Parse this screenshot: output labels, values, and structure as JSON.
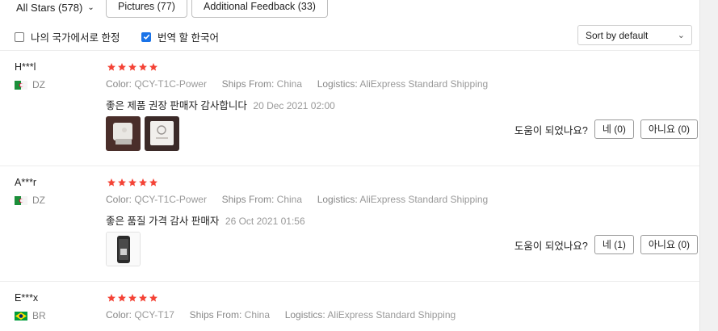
{
  "filters": {
    "all_stars": "All Stars (578)",
    "pictures": "Pictures (77)",
    "additional_feedback": "Additional Feedback (33)"
  },
  "checkboxes": {
    "local_country": {
      "label": "나의 국가에서로 한정",
      "checked": false
    },
    "translate": {
      "label": "번역 할 한국어",
      "checked": true
    }
  },
  "sort": {
    "selected": "Sort by default"
  },
  "labels": {
    "color": "Color:",
    "ships_from": "Ships From:",
    "logistics": "Logistics:",
    "helpful_q": "도움이 되었나요?"
  },
  "colors": {
    "star": "#f44336",
    "checkbox": "#1a73e8"
  },
  "reviews": [
    {
      "user": "H***l",
      "country": "DZ",
      "flag_icon": "algeria-flag-icon",
      "rating": 5,
      "color": "QCY-T1C-Power",
      "ships_from": "China",
      "logistics": "AliExpress Standard Shipping",
      "text": "좋은 제품 권장 판매자 감사합니다",
      "date": "20 Dec 2021 02:00",
      "photos": 2,
      "yes": "네 (0)",
      "no": "아니요 (0)"
    },
    {
      "user": "A***r",
      "country": "DZ",
      "flag_icon": "algeria-flag-icon",
      "rating": 5,
      "color": "QCY-T1C-Power",
      "ships_from": "China",
      "logistics": "AliExpress Standard Shipping",
      "text": "좋은 품질 가격 감사 판매자",
      "date": "26 Oct 2021 01:56",
      "photos": 1,
      "yes": "네 (1)",
      "no": "아니요 (0)"
    },
    {
      "user": "E***x",
      "country": "BR",
      "flag_icon": "brazil-flag-icon",
      "rating": 5,
      "color": "QCY-T17",
      "ships_from": "China",
      "logistics": "AliExpress Standard Shipping"
    }
  ]
}
